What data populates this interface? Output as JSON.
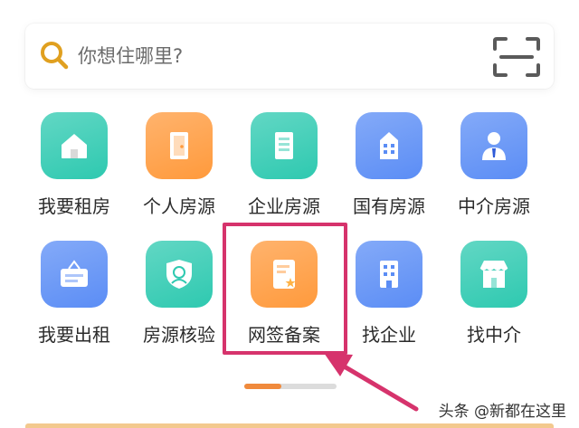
{
  "search": {
    "placeholder": "你想住哪里?"
  },
  "icons": {
    "search": "search-icon",
    "scan": "scan-icon"
  },
  "grid": [
    {
      "label": "我要租房",
      "icon": "home-icon",
      "color": "#2ec9b0"
    },
    {
      "label": "个人房源",
      "icon": "door-icon",
      "color": "#ff9a3c"
    },
    {
      "label": "企业房源",
      "icon": "building-icon",
      "color": "#2ec9b0"
    },
    {
      "label": "国有房源",
      "icon": "office-building-icon",
      "color": "#5b8df5"
    },
    {
      "label": "中介房源",
      "icon": "agent-icon",
      "color": "#5b8df5"
    },
    {
      "label": "我要出租",
      "icon": "rent-sign-icon",
      "color": "#5b8df5"
    },
    {
      "label": "房源核验",
      "icon": "face-verify-icon",
      "color": "#2ec9b0"
    },
    {
      "label": "网签备案",
      "icon": "contract-icon",
      "color": "#ff9a3c"
    },
    {
      "label": "找企业",
      "icon": "company-icon",
      "color": "#5b8df5"
    },
    {
      "label": "找中介",
      "icon": "storefront-icon",
      "color": "#2ec9b0"
    }
  ],
  "highlighted_item": "网签备案",
  "pager": {
    "current_fraction": 0.4
  },
  "watermark": "头条 @新都在这里",
  "colors": {
    "accent_orange": "#f08a3c",
    "highlight": "#d6336c",
    "search_icon": "#e0a020"
  }
}
